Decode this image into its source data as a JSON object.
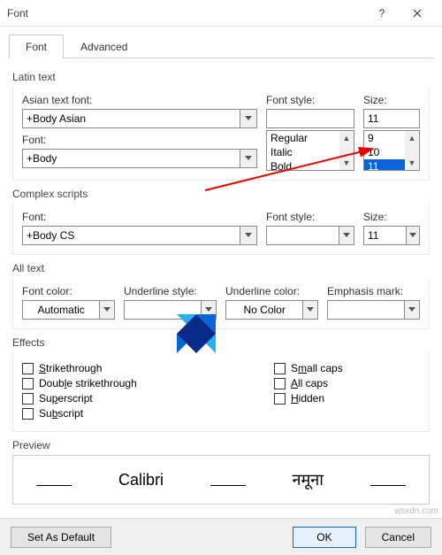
{
  "titlebar": {
    "title": "Font"
  },
  "tabs": {
    "font": "Font",
    "advanced": "Advanced"
  },
  "latin": {
    "title": "Latin text",
    "asian_label": "Asian text font:",
    "asian_value": "+Body Asian",
    "font_label": "Font:",
    "font_value": "+Body",
    "style_label": "Font style:",
    "style_value": "",
    "style_items": [
      "Regular",
      "Italic",
      "Bold"
    ],
    "size_label": "Size:",
    "size_value": "11",
    "size_items": [
      "9",
      "10",
      "11"
    ],
    "size_selected": "11"
  },
  "complex": {
    "title": "Complex scripts",
    "font_label": "Font:",
    "font_value": "+Body CS",
    "style_label": "Font style:",
    "style_value": "",
    "size_label": "Size:",
    "size_value": "11"
  },
  "alltext": {
    "title": "All text",
    "color_label": "Font color:",
    "color_value": "Automatic",
    "ustyle_label": "Underline style:",
    "ustyle_value": "",
    "ucolor_label": "Underline color:",
    "ucolor_value": "No Color",
    "emph_label": "Emphasis mark:",
    "emph_value": ""
  },
  "effects": {
    "title": "Effects",
    "strike": "Strikethrough",
    "dstrike": "Double strikethrough",
    "sup": "Superscript",
    "sub": "Subscript",
    "smallcaps": "Small caps",
    "allcaps": "All caps",
    "hidden": "Hidden"
  },
  "preview": {
    "title": "Preview",
    "latin": "Calibri",
    "complex": "नमूना"
  },
  "footer": {
    "default": "Set As Default",
    "ok": "OK",
    "cancel": "Cancel"
  },
  "watermark": "wsxdn.com"
}
